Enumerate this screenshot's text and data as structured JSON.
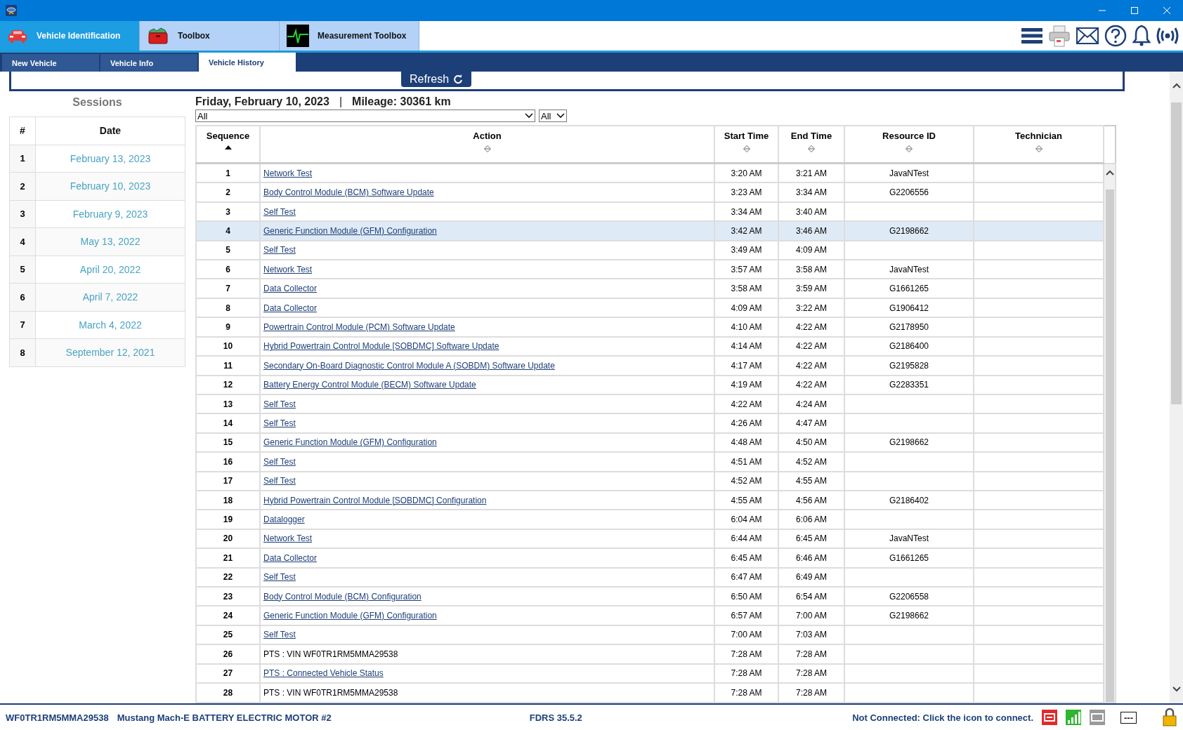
{
  "app_tabs": [
    {
      "label": "Vehicle Identification",
      "selected": true
    },
    {
      "label": "Toolbox",
      "selected": false
    },
    {
      "label": "Measurement Toolbox",
      "selected": false
    }
  ],
  "sub_tabs": [
    {
      "label": "New Vehicle",
      "selected": false
    },
    {
      "label": "Vehicle Info",
      "selected": false
    },
    {
      "label": "Vehicle History",
      "selected": true
    }
  ],
  "refresh_button": "Refresh",
  "sessions": {
    "title": "Sessions",
    "columns": [
      "#",
      "Date"
    ],
    "rows": [
      {
        "number": "1",
        "date": "February 13, 2023"
      },
      {
        "number": "2",
        "date": "February 10, 2023"
      },
      {
        "number": "3",
        "date": "February 9, 2023"
      },
      {
        "number": "4",
        "date": "May 13, 2022"
      },
      {
        "number": "5",
        "date": "April 20, 2022"
      },
      {
        "number": "6",
        "date": "April 7, 2022"
      },
      {
        "number": "7",
        "date": "March 4, 2022"
      },
      {
        "number": "8",
        "date": "September 12, 2021"
      }
    ]
  },
  "history": {
    "date": "Friday, February 10, 2023",
    "separator": "|",
    "mileage": "Mileage: 30361 km",
    "filters": [
      "All",
      "All"
    ],
    "columns": [
      {
        "label": "Sequence",
        "sorted": true
      },
      {
        "label": "Action",
        "sorted": false
      },
      {
        "label": "Start Time",
        "sorted": false
      },
      {
        "label": "End Time",
        "sorted": false
      },
      {
        "label": "Resource ID",
        "sorted": false
      },
      {
        "label": "Technician",
        "sorted": false
      }
    ],
    "rows": [
      {
        "sequence": "1",
        "action": "Network Test",
        "kind": "link",
        "start": "3:20 AM",
        "end": "3:21 AM",
        "resource": "JavaNTest",
        "selected": false
      },
      {
        "sequence": "2",
        "action": "Body Control Module (BCM) Software Update",
        "kind": "link",
        "start": "3:23 AM",
        "end": "3:34 AM",
        "resource": "G2206556",
        "selected": false
      },
      {
        "sequence": "3",
        "action": "Self Test",
        "kind": "link",
        "start": "3:34 AM",
        "end": "3:40 AM",
        "selected": false
      },
      {
        "sequence": "4",
        "action": "Generic Function Module (GFM) Configuration",
        "kind": "link",
        "start": "3:42 AM",
        "end": "3:46 AM",
        "resource": "G2198662",
        "selected": true
      },
      {
        "sequence": "5",
        "action": "Self Test",
        "kind": "link",
        "start": "3:49 AM",
        "end": "4:09 AM",
        "selected": false
      },
      {
        "sequence": "6",
        "action": "Network Test",
        "kind": "link",
        "start": "3:57 AM",
        "end": "3:58 AM",
        "resource": "JavaNTest",
        "selected": false
      },
      {
        "sequence": "7",
        "action": "Data Collector",
        "kind": "link",
        "start": "3:58 AM",
        "end": "3:59 AM",
        "resource": "G1661265",
        "selected": false
      },
      {
        "sequence": "8",
        "action": "Data Collector",
        "kind": "link",
        "start": "4:09 AM",
        "end": "3:22 AM",
        "resource": "G1906412",
        "selected": false
      },
      {
        "sequence": "9",
        "action": "Powertrain Control Module (PCM) Software Update",
        "kind": "link",
        "start": "4:10 AM",
        "end": "4:22 AM",
        "resource": "G2178950",
        "selected": false
      },
      {
        "sequence": "10",
        "action": "Hybrid Powertrain Control Module [SOBDMC] Software Update",
        "kind": "link",
        "start": "4:14 AM",
        "end": "4:22 AM",
        "resource": "G2186400",
        "selected": false
      },
      {
        "sequence": "11",
        "action": "Secondary On-Board Diagnostic Control Module A (SOBDM) Software Update",
        "kind": "link",
        "start": "4:17 AM",
        "end": "4:22 AM",
        "resource": "G2195828",
        "selected": false
      },
      {
        "sequence": "12",
        "action": "Battery Energy Control Module (BECM) Software Update",
        "kind": "link",
        "start": "4:19 AM",
        "end": "4:22 AM",
        "resource": "G2283351",
        "selected": false
      },
      {
        "sequence": "13",
        "action": "Self Test",
        "kind": "link",
        "start": "4:22 AM",
        "end": "4:24 AM",
        "selected": false
      },
      {
        "sequence": "14",
        "action": "Self Test",
        "kind": "link",
        "start": "4:26 AM",
        "end": "4:47 AM",
        "selected": false
      },
      {
        "sequence": "15",
        "action": "Generic Function Module (GFM) Configuration",
        "kind": "link",
        "start": "4:48 AM",
        "end": "4:50 AM",
        "resource": "G2198662",
        "selected": false
      },
      {
        "sequence": "16",
        "action": "Self Test",
        "kind": "link",
        "start": "4:51 AM",
        "end": "4:52 AM",
        "selected": false
      },
      {
        "sequence": "17",
        "action": "Self Test",
        "kind": "link",
        "start": "4:52 AM",
        "end": "4:55 AM",
        "selected": false
      },
      {
        "sequence": "18",
        "action": "Hybrid Powertrain Control Module [SOBDMC] Configuration",
        "kind": "link",
        "start": "4:55 AM",
        "end": "4:56 AM",
        "resource": "G2186402",
        "selected": false
      },
      {
        "sequence": "19",
        "action": "Datalogger",
        "kind": "link",
        "start": "6:04 AM",
        "end": "6:06 AM",
        "selected": false
      },
      {
        "sequence": "20",
        "action": "Network Test",
        "kind": "link",
        "start": "6:44 AM",
        "end": "6:45 AM",
        "resource": "JavaNTest",
        "selected": false
      },
      {
        "sequence": "21",
        "action": "Data Collector",
        "kind": "link",
        "start": "6:45 AM",
        "end": "6:46 AM",
        "resource": "G1661265",
        "selected": false
      },
      {
        "sequence": "22",
        "action": "Self Test",
        "kind": "link",
        "start": "6:47 AM",
        "end": "6:49 AM",
        "selected": false
      },
      {
        "sequence": "23",
        "action": "Body Control Module (BCM) Configuration",
        "kind": "link",
        "start": "6:50 AM",
        "end": "6:54 AM",
        "resource": "G2206558",
        "selected": false
      },
      {
        "sequence": "24",
        "action": "Generic Function Module (GFM) Configuration",
        "kind": "link",
        "start": "6:57 AM",
        "end": "7:00 AM",
        "resource": "G2198662",
        "selected": false
      },
      {
        "sequence": "25",
        "action": "Self Test",
        "kind": "link",
        "start": "7:00 AM",
        "end": "7:03 AM",
        "selected": false
      },
      {
        "sequence": "26",
        "action": "PTS : VIN WF0TR1RM5MMA29538",
        "kind": "text",
        "start": "7:28 AM",
        "end": "7:28 AM",
        "selected": false
      },
      {
        "sequence": "27",
        "action": "PTS : Connected Vehicle Status",
        "kind": "link",
        "start": "7:28 AM",
        "end": "7:28 AM",
        "selected": false
      },
      {
        "sequence": "28",
        "action": "PTS : VIN WF0TR1RM5MMA29538",
        "kind": "text",
        "start": "7:28 AM",
        "end": "7:28 AM",
        "selected": false
      }
    ]
  },
  "status_bar": {
    "vin": "WF0TR1RM5MMA29538",
    "vehicle": "Mustang Mach-E BATTERY ELECTRIC MOTOR #2",
    "version": "FDRS 35.5.2",
    "connection": "Not Connected: Click the icon to connect.",
    "indicator": "---"
  }
}
